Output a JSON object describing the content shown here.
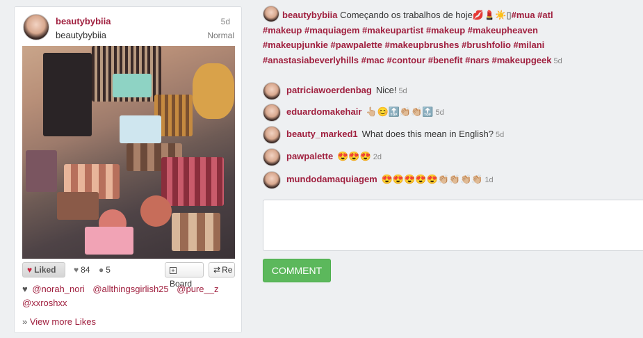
{
  "post": {
    "username": "beautybybiia",
    "display_name": "beautybybiia",
    "time": "5d",
    "filter": "Normal",
    "liked_label": "Liked",
    "like_count": "84",
    "comment_count": "5",
    "board_label": "Board",
    "repost_label": "Re",
    "likers": [
      "@norah_nori",
      "@allthingsgirlish25",
      "@pure__z",
      "@xxroshxx"
    ],
    "view_more_label": "View more Likes"
  },
  "caption": {
    "username": "beautybybiia",
    "text": "Começando os trabalhos de hoje💋💄☀️▯",
    "tags": "#mua #atl #makeup #maquiagem #makeupartist #makeup #makeupheaven #makeupjunkie #pawpalette #makeupbrushes #brushfolio #milani #anastasiabeverlyhills #mac #contour #benefit #nars #makeupgeek",
    "time": "5d"
  },
  "comments": [
    {
      "user": "patriciawoerdenbag",
      "text": "Nice!",
      "time": "5d"
    },
    {
      "user": "eduardomakehair",
      "text": "👆🏼😊🔝👏🏼👏🏼🔝",
      "time": "5d"
    },
    {
      "user": "beauty_marked1",
      "text": "What does this mean in English?",
      "time": "5d"
    },
    {
      "user": "pawpalette",
      "text": "😍😍😍",
      "time": "2d"
    },
    {
      "user": "mundodamaquiagem",
      "text": "😍😍😍😍😍👏🏼👏🏼👏🏼👏🏼",
      "time": "1d"
    }
  ],
  "comment_form": {
    "placeholder": "",
    "submit_label": "COMMENT"
  },
  "icons": {
    "heart": "heart-icon",
    "comment": "comment-bubble-icon",
    "board": "plus-icon",
    "repost": "repost-icon",
    "arrow": "double-chevron-icon"
  },
  "colors": {
    "accent": "#a0203f",
    "button_green": "#5cb85c",
    "background": "#eef0f2"
  }
}
